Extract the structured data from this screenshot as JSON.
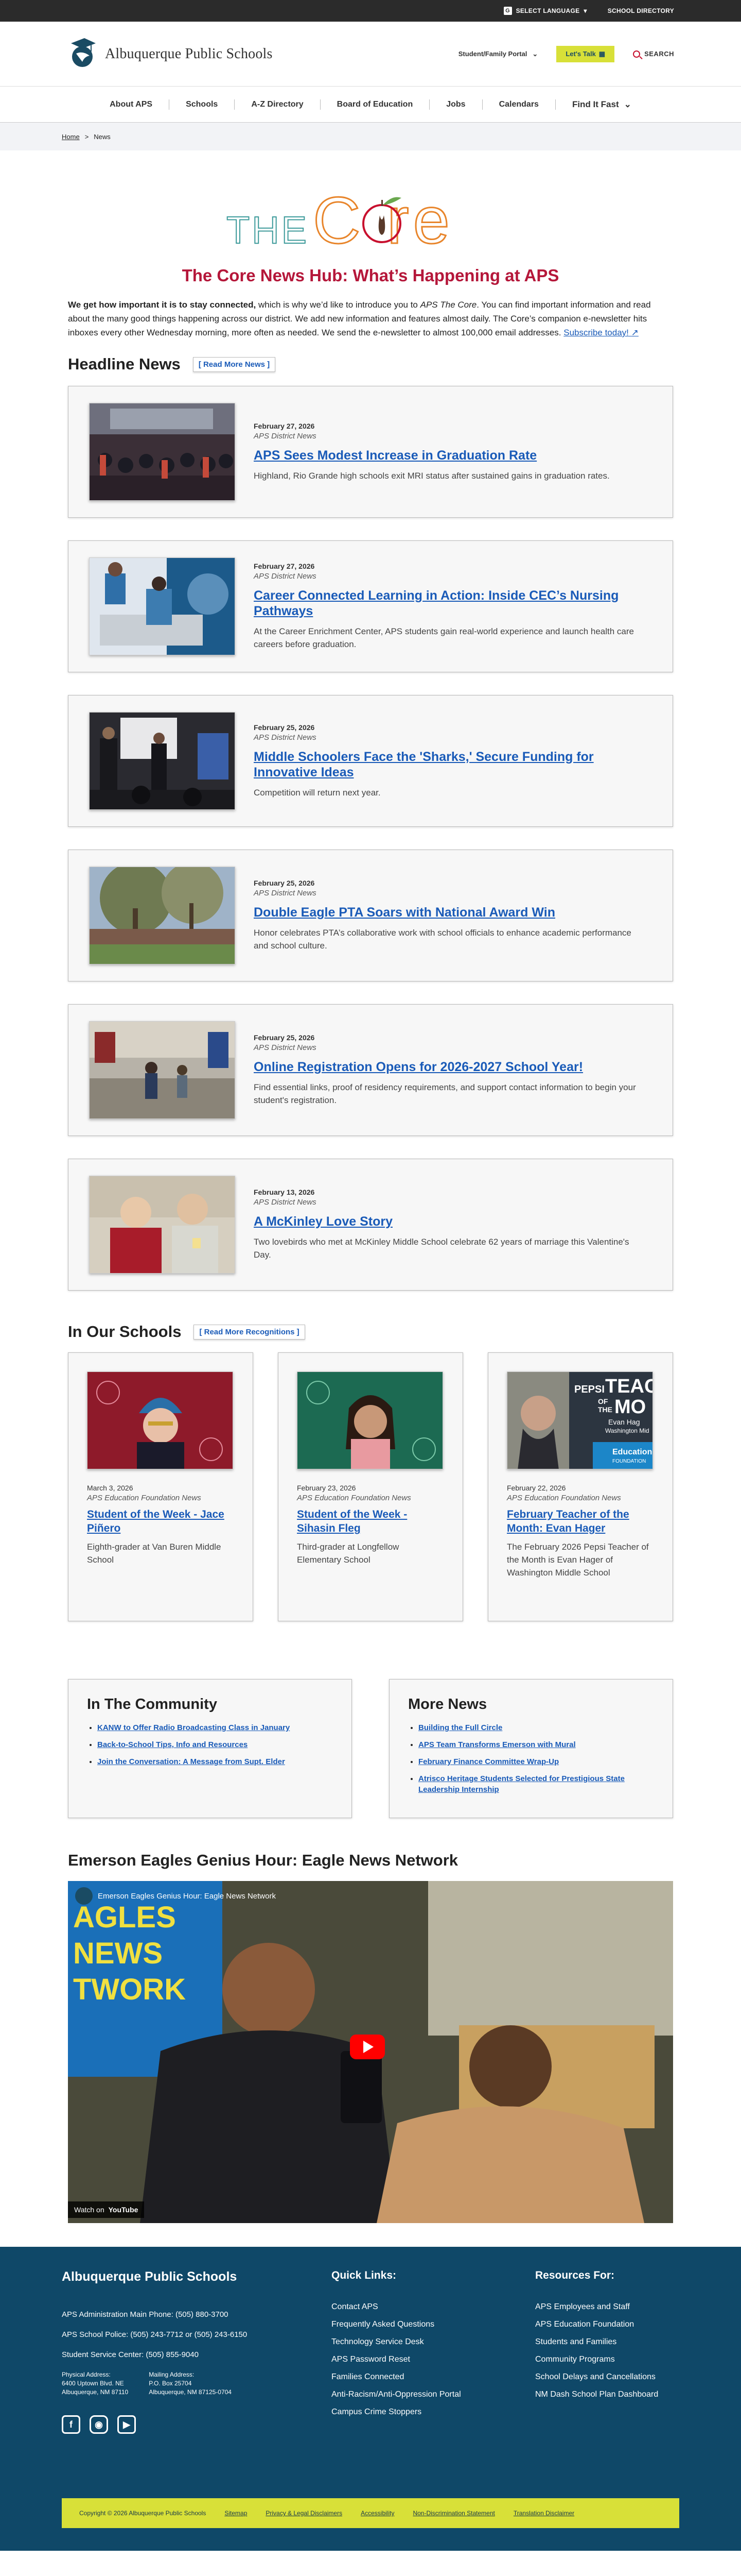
{
  "utility": {
    "language": "SELECT LANGUAGE",
    "directory": "SCHOOL DIRECTORY"
  },
  "header": {
    "brand": "Albuquerque Public Schools",
    "portal": "Student/Family Portal",
    "talk": "Let's Talk",
    "search": "SEARCH"
  },
  "nav": [
    "About APS",
    "Schools",
    "A-Z Directory",
    "Board of Education",
    "Jobs",
    "Calendars",
    "Find It Fast"
  ],
  "breadcrumb": {
    "home": "Home",
    "sep": ">",
    "current": "News"
  },
  "core": {
    "logo_the": "THE",
    "logo_core": "C re",
    "title": "The Core News Hub: What’s Happening at APS",
    "intro_bold": "We get how important it is to stay connected,",
    "intro_a": " which is why we’d like to introduce you to ",
    "intro_em": "APS The Core",
    "intro_b": ". You can find important information and read about the many good things happening across our district. We add new information and features almost daily. The Core’s companion e-newsletter hits inboxes every other Wednesday morning, more often as needed. We send the e-newsletter to almost 100,000 email addresses. ",
    "subscribe": "Subscribe today!"
  },
  "headline": {
    "title": "Headline News",
    "readmore": "[ Read More News ]",
    "stories": [
      {
        "date": "February 27, 2026",
        "source": "APS District News",
        "title": "APS Sees Modest Increase in Graduation Rate",
        "desc": "Highland, Rio Grande high schools exit MRI status after sustained gains in graduation rates."
      },
      {
        "date": "February 27, 2026",
        "source": "APS District News",
        "title": "Career Connected Learning in Action: Inside CEC’s Nursing Pathways",
        "desc": "At the Career Enrichment Center, APS students gain real-world experience and launch health care careers before graduation."
      },
      {
        "date": "February 25, 2026",
        "source": "APS District News",
        "title": "Middle Schoolers Face the 'Sharks,' Secure Funding for Innovative Ideas",
        "desc": "Competition will return next year."
      },
      {
        "date": "February 25, 2026",
        "source": "APS District News",
        "title": "Double Eagle PTA Soars with National Award Win",
        "desc": "Honor celebrates PTA’s collaborative work with school officials to enhance academic performance and school culture."
      },
      {
        "date": "February 25, 2026",
        "source": "APS District News",
        "title": "Online Registration Opens for 2026-2027 School Year!",
        "desc": "Find essential links, proof of residency requirements, and support contact information to begin your student's registration."
      },
      {
        "date": "February 13, 2026",
        "source": "APS District News",
        "title": "A McKinley Love Story",
        "desc": "Two lovebirds who met at McKinley Middle School celebrate 62 years of marriage this Valentine's Day."
      }
    ]
  },
  "schools": {
    "title": "In Our Schools",
    "readmore": "[ Read More Recognitions ]",
    "cards": [
      {
        "date": "March 3, 2026",
        "source": "APS Education Foundation News",
        "title": "Student of the Week - Jace Piñero",
        "desc": "Eighth-grader at Van Buren Middle School"
      },
      {
        "date": "February 23, 2026",
        "source": "APS Education Foundation News",
        "title": "Student of the Week - Sihasin Fleg",
        "desc": "Third-grader at Longfellow Elementary School"
      },
      {
        "date": "February 22, 2026",
        "source": "APS Education Foundation News",
        "title": "February Teacher of the Month: Evan Hager",
        "desc": "The February 2026 Pepsi Teacher of the Month is Evan Hager of Washington Middle School"
      }
    ],
    "poster": {
      "pepsi": "PEPSI",
      "teach": "TEAC",
      "of": "OF",
      "the": "THE",
      "mo": "MO",
      "name": "Evan Hag",
      "school": "Washington Mid",
      "edu": "Education",
      "foundation": "FOUNDATION"
    }
  },
  "community": {
    "title": "In The Community",
    "items": [
      "KANW to Offer Radio Broadcasting Class in January",
      "Back-to-School Tips, Info and Resources",
      "Join the Conversation: A Message from Supt. Elder"
    ]
  },
  "more": {
    "title": "More News",
    "items": [
      "Building the Full Circle",
      "APS Team Transforms Emerson with Mural",
      "February Finance Committee Wrap-Up",
      "Atrisco Heritage Students Selected for Prestigious State Leadership Internship"
    ]
  },
  "video": {
    "title": "Emerson Eagles Genius Hour: Eagle News Network",
    "label": "Emerson Eagles Genius Hour: Eagle News Network",
    "watch": "Watch on",
    "yt": "YouTube",
    "bg_words": [
      "AGLES",
      "NEWS",
      "TWORK"
    ]
  },
  "footer": {
    "brand": "Albuquerque Public Schools",
    "phone1": "APS Administration Main Phone: (505) 880-3700",
    "phone2": "APS School Police: (505) 243-7712 or (505) 243-6150",
    "phone3": "Student Service Center: (505) 855-9040",
    "phys_label": "Physical Address:",
    "phys1": "6400 Uptown Blvd. NE",
    "phys2": "Albuquerque, NM 87110",
    "mail_label": "Mailing Address:",
    "mail1": "P.O. Box 25704",
    "mail2": "Albuquerque, NM 87125-0704",
    "quick_title": "Quick Links:",
    "quick": [
      "Contact APS",
      "Frequently Asked Questions",
      "Technology Service Desk",
      "APS Password Reset",
      "Families Connected",
      "Anti-Racism/Anti-Oppression Portal",
      "Campus Crime Stoppers"
    ],
    "res_title": "Resources For:",
    "resources": [
      "APS Employees and Staff",
      "APS Education Foundation",
      "Students and Families",
      "Community Programs",
      "School Delays and Cancellations",
      "NM Dash School Plan Dashboard"
    ],
    "copyright": "Copyright © 2026 Albuquerque Public Schools",
    "legal": [
      "Sitemap",
      "Privacy & Legal Disclaimers",
      "Accessibility",
      "Non-Discrimination Statement",
      "Translation Disclaimer"
    ]
  },
  "colors": {
    "accent": "#b5173a",
    "link": "#1a5bb8",
    "footer": "#0f4868",
    "lime": "#d8e038"
  }
}
